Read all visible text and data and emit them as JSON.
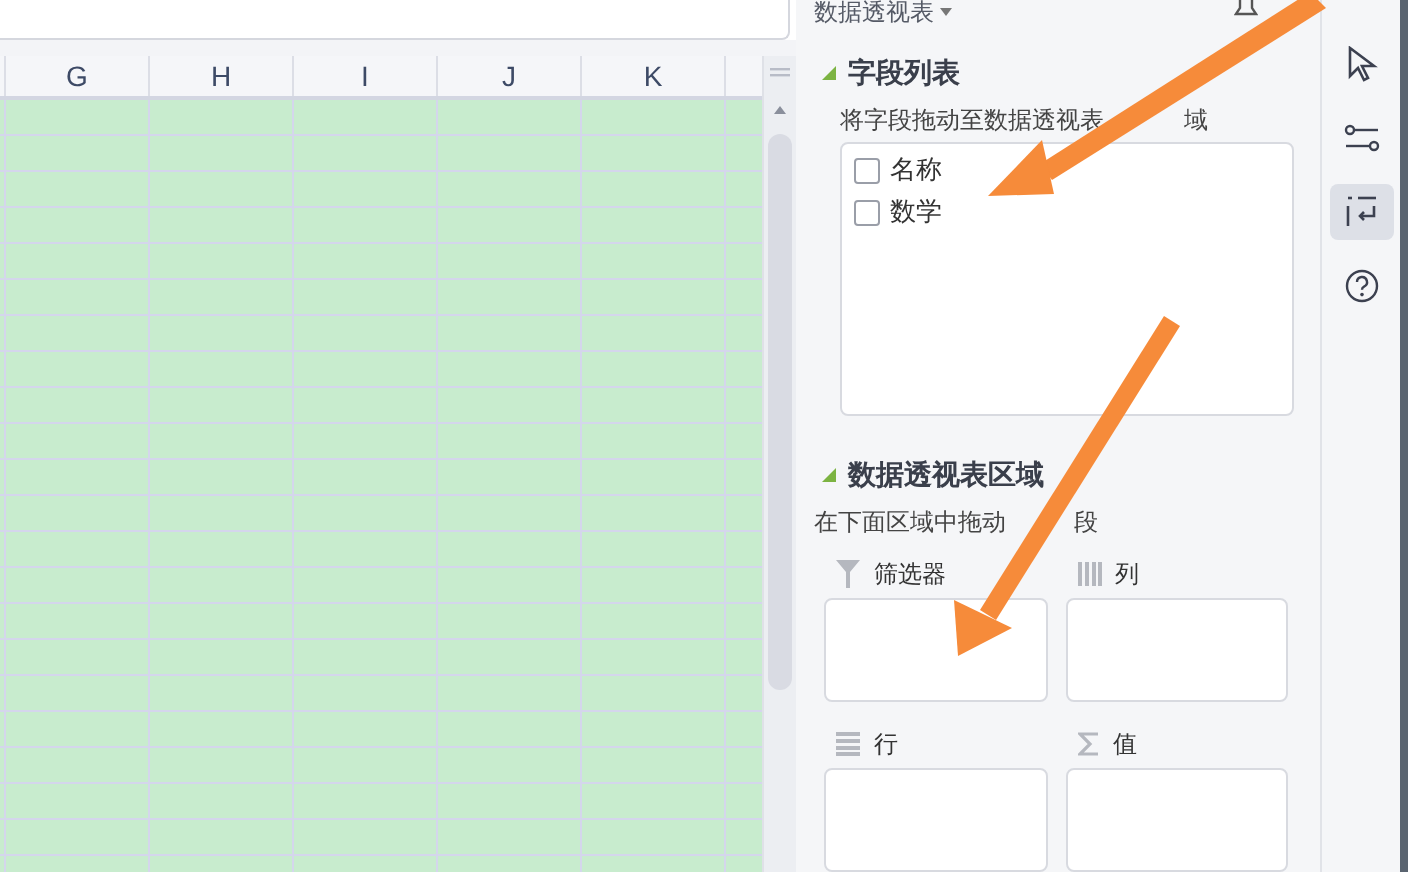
{
  "columns": [
    "G",
    "H",
    "I",
    "J",
    "K"
  ],
  "panel": {
    "title": "数据透视表",
    "field_list": {
      "heading": "字段列表",
      "hint_parts": [
        "将字段拖动至数据透视表",
        "域"
      ],
      "fields": [
        {
          "label": "名称",
          "checked": false
        },
        {
          "label": "数学",
          "checked": false
        }
      ]
    },
    "areas_section": {
      "heading": "数据透视表区域",
      "hint_parts": [
        "在下面区域中拖动",
        "段"
      ],
      "areas": [
        {
          "kind": "filter",
          "label": "筛选器"
        },
        {
          "kind": "columns",
          "label": "列"
        },
        {
          "kind": "rows",
          "label": "行"
        },
        {
          "kind": "values",
          "label": "值"
        }
      ]
    }
  },
  "side_toolbar": [
    {
      "kind": "cursor",
      "selected": false
    },
    {
      "kind": "sliders",
      "selected": false
    },
    {
      "kind": "pivot",
      "selected": true
    },
    {
      "kind": "help",
      "selected": false
    }
  ]
}
